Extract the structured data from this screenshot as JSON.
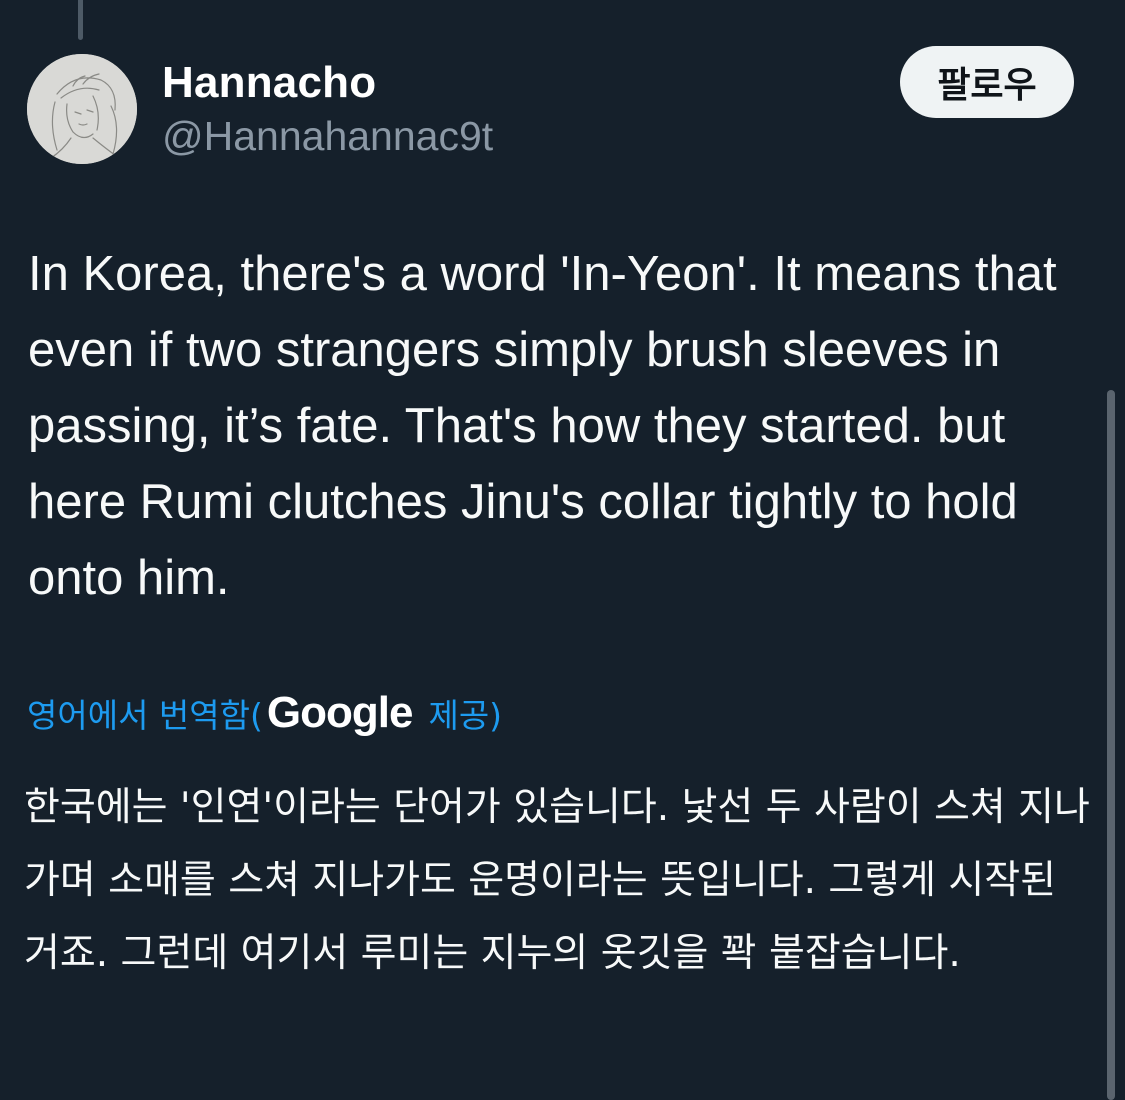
{
  "user": {
    "display_name": "Hannacho",
    "handle": "@Hannahannac9t",
    "avatar_icon": "sketch-portrait-avatar"
  },
  "follow_button": {
    "label": "팔로우"
  },
  "tweet": {
    "text": "In Korea, there's a word 'In-Yeon'. It means that even if two strangers simply brush sleeves in passing, it’s fate. That's how they started. but here Rumi clutches Jinu's collar tightly to hold onto him."
  },
  "translation": {
    "prefix": "영어에서 번역함(",
    "provider": "Google",
    "suffix": "제공)",
    "text": "한국에는 '인연'이라는 단어가 있습니다. 낯선 두 사람이 스쳐 지나가며 소매를 스쳐 지나가도 운명이라는 뜻입니다. 그렇게 시작된 거죠. 그런데 여기서 루미는 지누의 옷깃을 꽉 붙잡습니다."
  },
  "colors": {
    "background": "#15202b",
    "link": "#1d9bf0",
    "secondary_text": "#8b98a5",
    "button_bg": "#eff3f4"
  }
}
